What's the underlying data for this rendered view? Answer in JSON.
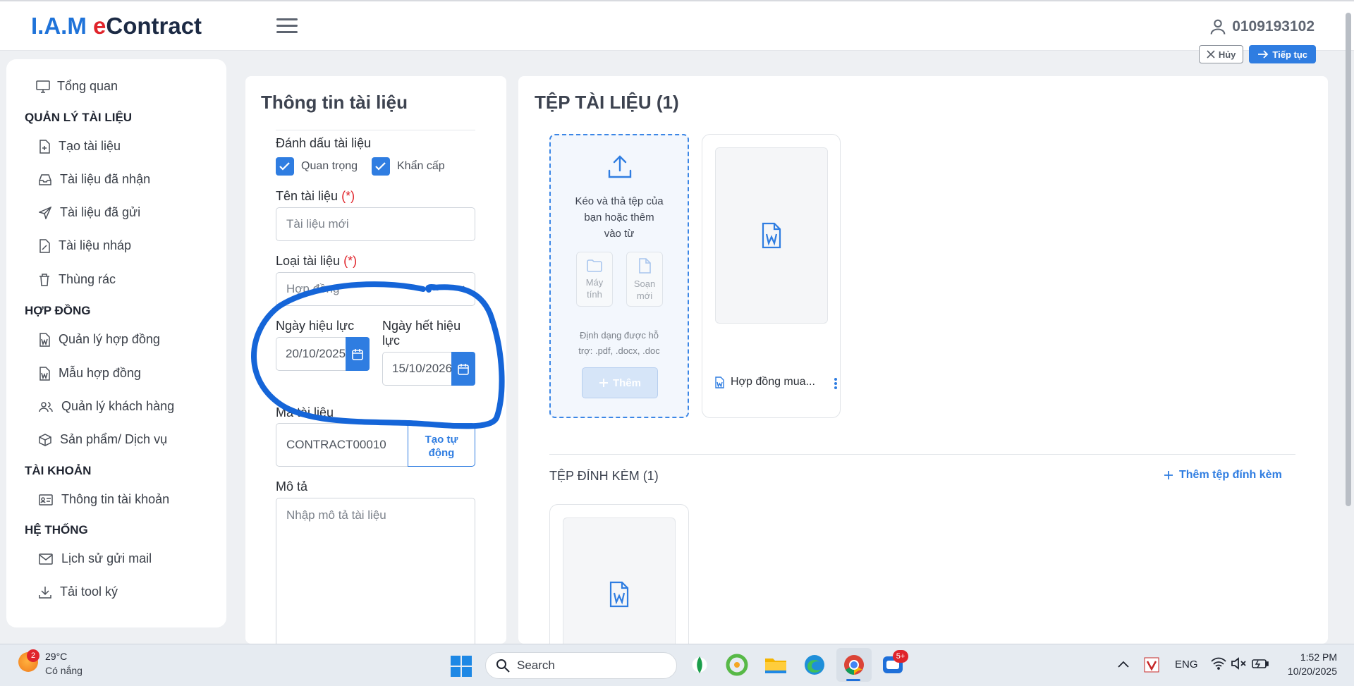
{
  "app": {
    "logo_iam": "I.A.M",
    "logo_e": "e",
    "logo_contract": "Contract",
    "user_id": "0109193102"
  },
  "actions": {
    "cancel": "Hủy",
    "next": "Tiếp tục"
  },
  "sidebar": {
    "overview": "Tổng quan",
    "sections": [
      "QUẢN LÝ TÀI LIỆU",
      "HỢP ĐỒNG",
      "TÀI KHOẢN",
      "HỆ THỐNG"
    ],
    "items": [
      {
        "label": "Tạo tài liệu",
        "icon": "file-plus-icon"
      },
      {
        "label": "Tài liệu đã nhận",
        "icon": "inbox-icon"
      },
      {
        "label": "Tài liệu đã gửi",
        "icon": "send-icon"
      },
      {
        "label": "Tài liệu nháp",
        "icon": "draft-icon"
      },
      {
        "label": "Thùng rác",
        "icon": "trash-icon"
      },
      {
        "label": "Quản lý hợp đồng",
        "icon": "word-file-icon"
      },
      {
        "label": "Mẫu hợp đồng",
        "icon": "word-file-icon"
      },
      {
        "label": "Quản lý khách hàng",
        "icon": "users-icon"
      },
      {
        "label": "Sản phẩm/ Dịch vụ",
        "icon": "box-icon"
      },
      {
        "label": "Thông tin tài khoản",
        "icon": "id-card-icon"
      },
      {
        "label": "Lịch sử gửi mail",
        "icon": "mail-icon"
      },
      {
        "label": "Tải tool ký",
        "icon": "download-icon"
      }
    ]
  },
  "form": {
    "title": "Thông tin tài liệu",
    "mark_label": "Đánh dấu tài liệu",
    "important": "Quan trọng",
    "urgent": "Khẩn cấp",
    "name_label": "Tên tài liệu",
    "required_mark": "(*)",
    "name_placeholder": "Tài liệu mới",
    "type_label": "Loại tài liệu",
    "type_value": "Hợp đồng",
    "start_label": "Ngày hiệu lực",
    "start_value": "20/10/2025",
    "end_label_1": "Ngày hết hiệu",
    "end_label_2": "lực",
    "end_value": "15/10/2026",
    "code_label": "Mã tài liệu",
    "code_value": "CONTRACT00010",
    "auto_btn_1": "Tạo tự",
    "auto_btn_2": "động",
    "desc_label": "Mô tả",
    "desc_placeholder": "Nhập mô tả tài liệu"
  },
  "files": {
    "title": "TỆP TÀI LIỆU (1)",
    "drop_1": "Kéo và thả tệp của",
    "drop_2": "bạn hoặc thêm",
    "drop_3": "vào từ",
    "src_computer_1": "Máy",
    "src_computer_2": "tính",
    "src_new_1": "Soạn",
    "src_new_2": "mới",
    "formats_1": "Định dạng được hỗ",
    "formats_2": "trợ: .pdf, .docx, .doc",
    "add": "Thêm",
    "file_name": "Hợp đồng mua...",
    "attach_title": "TỆP ĐÍNH KÈM (1)",
    "add_attach": "Thêm tệp đính kèm"
  },
  "taskbar": {
    "temp": "29°C",
    "weather": "Có nắng",
    "weather_badge": "2",
    "search": "Search",
    "zalo_badge": "5+",
    "lang": "ENG",
    "time": "1:52 PM",
    "date": "10/20/2025"
  },
  "colors": {
    "accent": "#2f7de1",
    "annotation": "#1565d8",
    "required": "#e0242b"
  }
}
